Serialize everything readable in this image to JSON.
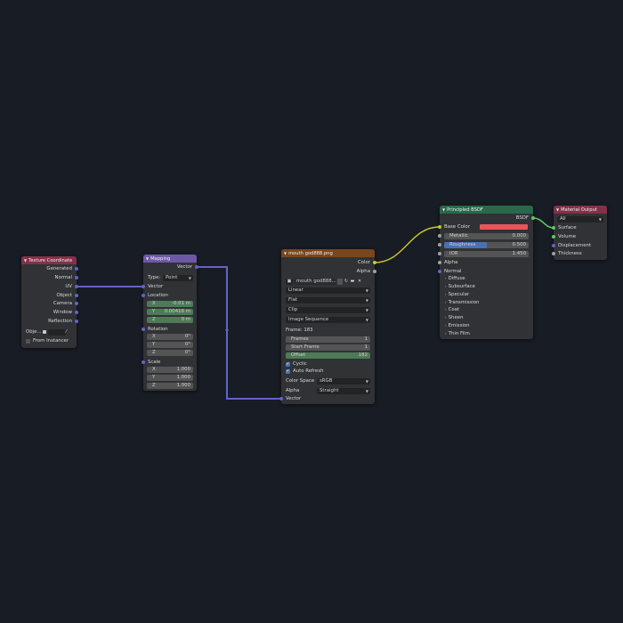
{
  "colors": {
    "background": "#181c24",
    "node_body": "#303236",
    "texcoord_header": "#83314a",
    "vector_header": "#6d58a8",
    "texture_header": "#79461d",
    "shader_header": "#29694a",
    "output_header": "#83314a",
    "link_vector": "#6363c7",
    "link_color": "#c7c729",
    "link_shader": "#63c763",
    "base_color_swatch": "#e8545b"
  },
  "texcoord": {
    "title": "Texture Coordinate",
    "outputs": [
      "Generated",
      "Normal",
      "UV",
      "Object",
      "Camera",
      "Window",
      "Reflection"
    ],
    "object_label": "Obje...",
    "object_placeholder": "",
    "from_instancer": "From Instancer"
  },
  "mapping": {
    "title": "Mapping",
    "output": "Vector",
    "type_label": "Type:",
    "type_value": "Point",
    "vector_input": "Vector",
    "location_label": "Location",
    "location": [
      {
        "axis": "X",
        "value": "-0.01 m"
      },
      {
        "axis": "Y",
        "value": "0.00416 m"
      },
      {
        "axis": "Z",
        "value": "0 m"
      }
    ],
    "rotation_label": "Rotation",
    "rotation": [
      {
        "axis": "X",
        "value": "0°"
      },
      {
        "axis": "Y",
        "value": "0°"
      },
      {
        "axis": "Z",
        "value": "0°"
      }
    ],
    "scale_label": "Scale",
    "scale": [
      {
        "axis": "X",
        "value": "1.000"
      },
      {
        "axis": "Y",
        "value": "1.000"
      },
      {
        "axis": "Z",
        "value": "1.000"
      }
    ]
  },
  "image": {
    "title": "mouth god888.png",
    "out_color": "Color",
    "out_alpha": "Alpha",
    "image_name": "mouth god888...",
    "interpolation": "Linear",
    "projection": "Flat",
    "extension": "Clip",
    "source": "Image Sequence",
    "frame_text": "Frame: 183",
    "frames_label": "Frames",
    "frames_value": "1",
    "start_label": "Start Frame",
    "start_value": "1",
    "offset_label": "Offset",
    "offset_value": "182",
    "cyclic": "Cyclic",
    "auto_refresh": "Auto Refresh",
    "colorspace_label": "Color Space",
    "colorspace_value": "sRGB",
    "alpha_label": "Alpha",
    "alpha_value": "Straight",
    "vector_input": "Vector"
  },
  "bsdf": {
    "title": "Principled BSDF",
    "output": "BSDF",
    "base_color": "Base Color",
    "metallic_label": "Metallic",
    "metallic_value": "0.000",
    "roughness_label": "Roughness",
    "roughness_value": "0.500",
    "roughness_fill": 0.5,
    "ior_label": "IOR",
    "ior_value": "1.450",
    "alpha": "Alpha",
    "normal": "Normal",
    "panels": [
      "Diffuse",
      "Subsurface",
      "Specular",
      "Transmission",
      "Coat",
      "Sheen",
      "Emission",
      "Thin Film"
    ]
  },
  "output": {
    "title": "Material Output",
    "target": "All",
    "inputs": [
      "Surface",
      "Volume",
      "Displacement",
      "Thickness"
    ]
  }
}
